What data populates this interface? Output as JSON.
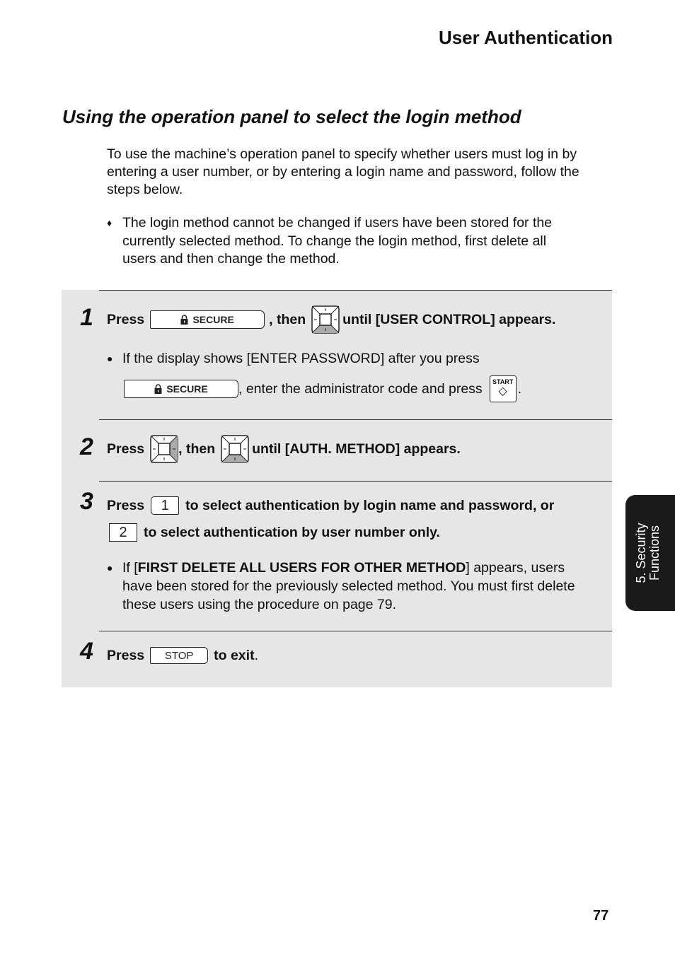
{
  "header": {
    "title": "User Authentication"
  },
  "section": {
    "title": "Using the operation panel to select the login method"
  },
  "intro": {
    "line1": "To use the machine’s operation panel to specify whether users must log in by",
    "line2": "entering a user number, or by entering a login name and password, follow the",
    "line3": "steps below."
  },
  "note": {
    "bullet": "♦",
    "line1": "The login method cannot be changed if users have been stored for the",
    "line2": "currently selected method. To change the login method, first delete all",
    "line3": "users and then change the method."
  },
  "keys": {
    "secure": "SECURE",
    "start": "START",
    "stop": "STOP",
    "one": "1",
    "two": "2",
    "lock_icon": "lock-icon",
    "start_symbol": "◇"
  },
  "steps": [
    {
      "number": "1",
      "press": "Press",
      "then": ", then",
      "until": "until [USER CONTROL] appears.",
      "bullet": "●",
      "sub1": "If the display shows [ENTER PASSWORD] after you press",
      "sub2": ", enter the administrator code and press",
      "sub2_end": "."
    },
    {
      "number": "2",
      "press": "Press",
      "then": ", then",
      "until": "until [AUTH. METHOD] appears."
    },
    {
      "number": "3",
      "press": "Press",
      "text1": "to select authentication by login name and password, or",
      "text2": "to select authentication by user number only.",
      "bullet": "●",
      "sub_prefix": "If [",
      "sub_bold": "FIRST DELETE ALL USERS FOR OTHER METHOD",
      "sub_suffix": "] appears, users",
      "sub_line2": "have been stored for the previously selected method. You must first delete",
      "sub_line3": "these users using the procedure on page 79."
    },
    {
      "number": "4",
      "press": "Press",
      "exit": "to exit",
      "period": "."
    }
  ],
  "side_tab": {
    "line1": "5. Security",
    "line2": "Functions"
  },
  "page_number": "77"
}
